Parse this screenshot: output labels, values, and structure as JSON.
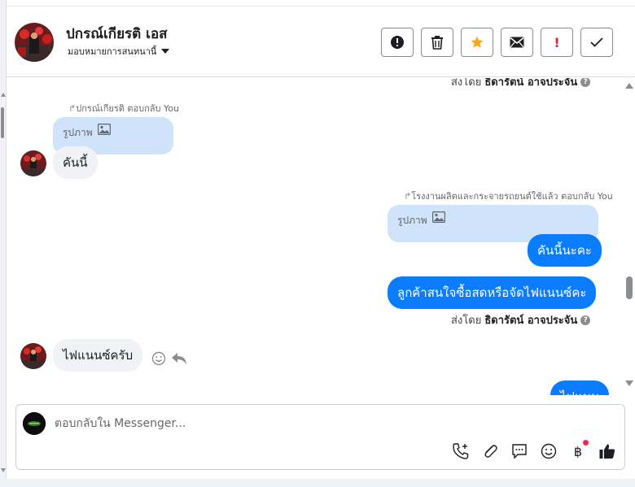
{
  "header": {
    "name": "ปกรณ์เกียรติ เอส",
    "assign_label": "มอบหมายการสนทนานี้"
  },
  "actions": {
    "spam_icon": "alert-circle-icon",
    "delete_icon": "trash-icon",
    "star_icon": "star-icon",
    "mail_icon": "envelope-icon",
    "important_label": "!",
    "done_icon": "check-icon",
    "star_color": "#f5a623",
    "important_color": "#e41e3f"
  },
  "thread": {
    "top_sent_by_prefix": "ส่งโดย",
    "top_sent_by_name": "ธิดารัตน์ อาจประจัน",
    "reply_note_1": "ปกรณ์เกียรติ ตอบกลับ You",
    "quote_1": "รูปภาพ",
    "msg_in_1": "คันนี้",
    "reply_note_2": "โรงงานผลิตและกระจายรถยนต์ใช้แล้ว ตอบกลับ You",
    "quote_2": "รูปภาพ",
    "msg_out_1": "คันนี้นะคะ",
    "msg_out_2": "ลูกค้าสนใจซื้อสดหรือจัดไฟแนนซ์คะ",
    "sent_by_prefix": "ส่งโดย",
    "sent_by_name": "ธิดารัตน์ อาจประจัน",
    "msg_in_2": "ไฟแนนซ์ครับ",
    "msg_out_3_partial": "ไฟแนน"
  },
  "composer": {
    "placeholder": "ตอบกลับใน Messenger...",
    "tools": [
      "phone-plus-icon",
      "paperclip-icon",
      "quick-reply-icon",
      "emoji-icon",
      "baht-icon",
      "thumbs-up-icon"
    ]
  },
  "colors": {
    "outgoing_bubble": "#0a7cff",
    "incoming_bubble": "#f0f2f5",
    "quote_bubble": "#cfe3fb",
    "notification_dot": "#f02849"
  }
}
